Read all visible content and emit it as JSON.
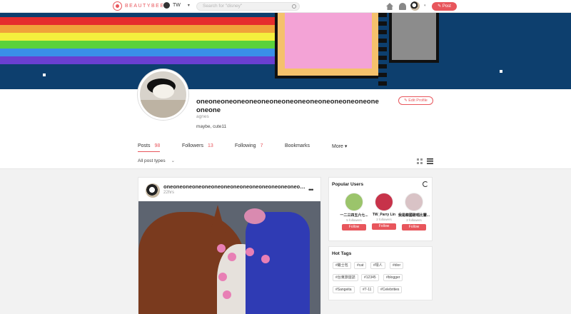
{
  "header": {
    "brand": "BEAUTYBEE",
    "region": "TW",
    "search_placeholder": "Search for \"disney\"",
    "post_label": "Post"
  },
  "profile": {
    "username": "oneoneoneoneoneoneoneoneoneoneoneoneoneoneoneoneone",
    "handle": "agnes",
    "bio": "maybe, cute11",
    "edit_label": "Edit Profile"
  },
  "tabs": [
    {
      "label": "Posts",
      "count": "98",
      "active": true
    },
    {
      "label": "Followers",
      "count": "13"
    },
    {
      "label": "Following",
      "count": "7"
    },
    {
      "label": "Bookmarks",
      "count": ""
    },
    {
      "label": "More ▾",
      "count": ""
    }
  ],
  "filter": {
    "label": "All post types"
  },
  "post": {
    "username": "oneoneoneoneoneoneoneoneoneoneoneoneoneoneoneoneone",
    "time": "22hrs"
  },
  "popular_users": {
    "title": "Popular Users",
    "users": [
      {
        "name": "一二三四五六七...",
        "followers": "5 followers",
        "follow": "Follow",
        "color": "#9bc46b"
      },
      {
        "name": "TW_Parry Lin",
        "followers": "2 followers",
        "follow": "Follow",
        "color": "#c7334a"
      },
      {
        "name": "我是韓國歌唱比賽...",
        "followers": "2 followers",
        "follow": "Follow",
        "color": "#d9c3c6"
      }
    ]
  },
  "hot_tags": {
    "title": "Hot Tags",
    "tags": [
      "#繼士包",
      "#cat",
      "#壞人",
      "#dior",
      "#台東旅遊誌",
      "#12345",
      "#blogger",
      "#Sangeita",
      "#7-11",
      "#Celebrities"
    ]
  },
  "colors": {
    "accent": "#e8565c",
    "banner_blue": "#0d3f6e"
  }
}
